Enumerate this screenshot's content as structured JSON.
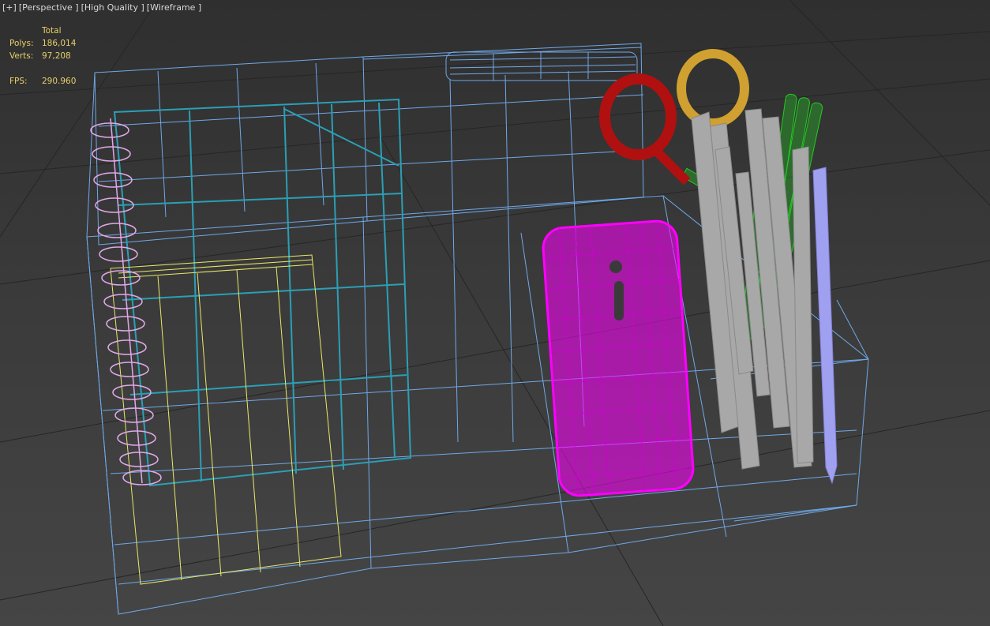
{
  "viewport": {
    "menus": [
      {
        "label": "[+]"
      },
      {
        "label": "[Perspective ]"
      },
      {
        "label": "[High Quality ]"
      },
      {
        "label": "[Wireframe ]"
      }
    ]
  },
  "stats": {
    "header": "Total",
    "polys_label": "Polys:",
    "polys_value": "186,014",
    "verts_label": "Verts:",
    "verts_value": "97,208",
    "fps_label": "FPS:",
    "fps_value": "290.960"
  },
  "colors": {
    "background": "#3b3b3b",
    "grid": "#2a2a2a",
    "organizer_wire": "#6fa8e8",
    "binder_wire": "#2b9fb5",
    "spiral": "#e0a8e8",
    "notepad": "#e8e86a",
    "phone": "#ff00ff",
    "ring_red": "#b01010",
    "ring_gold": "#d0a030",
    "pens_green": "#22cc22",
    "pens_gray": "#a8a8a8",
    "pencil_violet": "#a0a0f0",
    "stats_text": "#e8cf6a"
  }
}
